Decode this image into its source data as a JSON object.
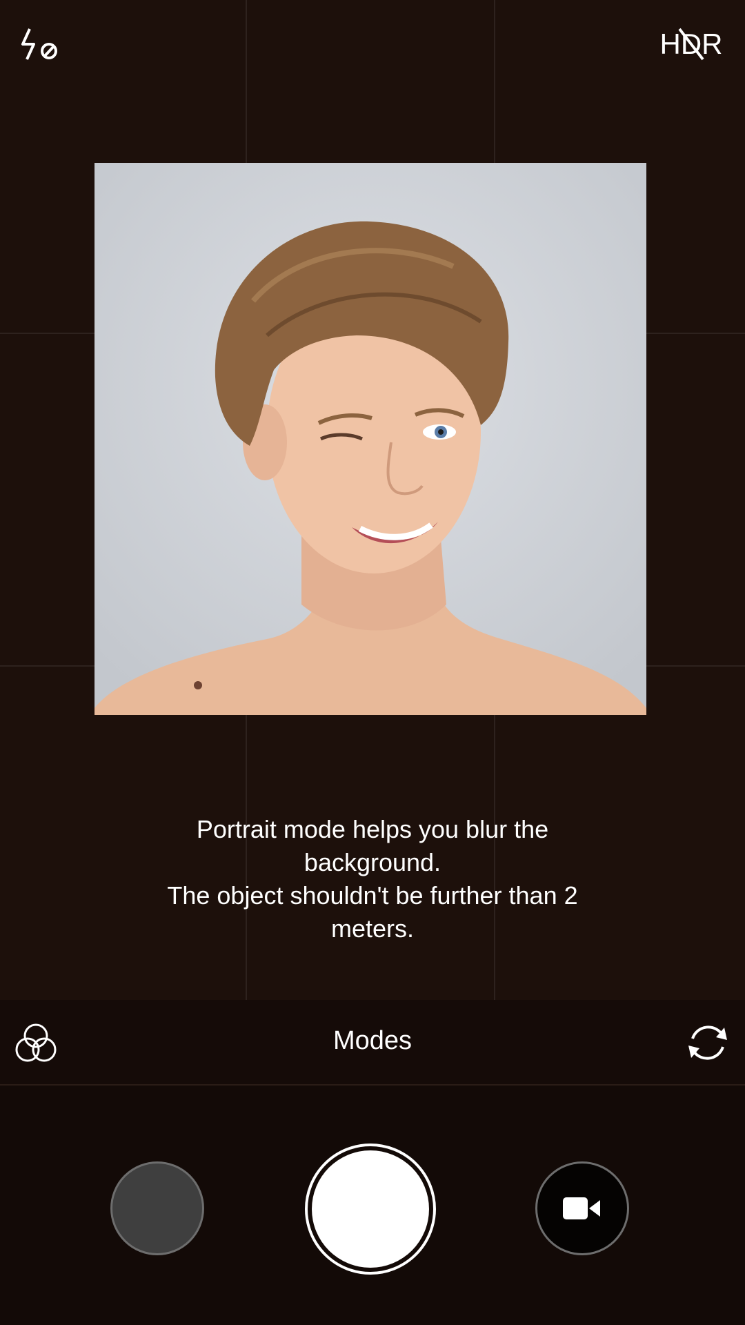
{
  "top_bar": {
    "flash_icon": "flash-off-icon",
    "hdr_label": "HDR",
    "hdr_icon": "hdr-off-icon"
  },
  "preview": {
    "subject": "portrait-photo"
  },
  "hint": {
    "line1": "Portrait mode helps you blur the\nbackground.",
    "line2": "The object shouldn't be further than 2\nmeters."
  },
  "modes_bar": {
    "filters_icon": "filters-icon",
    "label": "Modes",
    "switch_icon": "switch-camera-icon"
  },
  "bottom_bar": {
    "gallery_icon": "gallery-thumbnail",
    "shutter_icon": "shutter-button",
    "video_icon": "video-camera-icon"
  },
  "colors": {
    "background": "#1c100b",
    "bar": "#130a07",
    "text": "#ffffff"
  }
}
